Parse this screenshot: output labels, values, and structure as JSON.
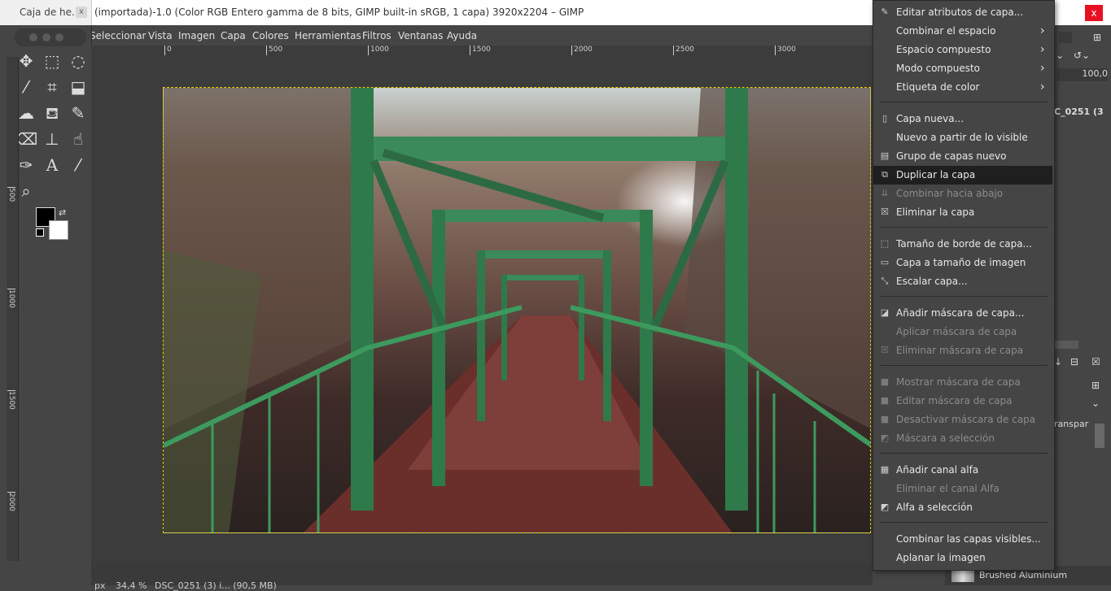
{
  "window": {
    "toolbox_title": "Caja de he...",
    "toolbox_close": "x",
    "title": "(importada)-1.0 (Color RGB Entero gamma de 8 bits, GIMP built-in sRGB, 1 capa) 3920x2204 – GIMP",
    "close": "x"
  },
  "menubar": [
    "Seleccionar",
    "Vista",
    "Imagen",
    "Capa",
    "Colores",
    "Herramientas",
    "Filtros",
    "Ventanas",
    "Ayuda"
  ],
  "ruler": {
    "horizontal": [
      "0",
      "500",
      "1000",
      "1500",
      "2000",
      "2500",
      "3000"
    ],
    "vertical": [
      "500",
      "1000",
      "1500",
      "2000"
    ]
  },
  "tools": {
    "move": "move-icon",
    "rect_select": "rect-select-icon",
    "lasso": "lasso-icon",
    "fuzzy": "fuzzy-select-icon",
    "crop": "crop-icon",
    "transform": "transform-icon",
    "warp": "warp-icon",
    "bucket": "bucket-fill-icon",
    "paintbrush": "paintbrush-icon",
    "eraser": "eraser-icon",
    "clone": "clone-icon",
    "smudge": "smudge-icon",
    "paths": "paths-icon",
    "text": "text-icon",
    "picker": "color-picker-icon",
    "zoom": "zoom-icon"
  },
  "right_dock": {
    "opacity": "100,0",
    "layer_name": "C_0251 (3",
    "mode_text": "ranspar",
    "pattern_name": "Brushed Aluminium"
  },
  "statusbar": {
    "unit": "px",
    "zoom": "34,4 %",
    "info": "DSC_0251 (3) i...  (90,5 MB)"
  },
  "context_menu": {
    "items": [
      {
        "label": "Editar atributos de capa...",
        "icon": "edit-attributes-icon",
        "disabled": false,
        "submenu": false
      },
      {
        "label": "Combinar el espacio",
        "icon": "",
        "disabled": false,
        "submenu": true
      },
      {
        "label": "Espacio compuesto",
        "icon": "",
        "disabled": false,
        "submenu": true
      },
      {
        "label": "Modo compuesto",
        "icon": "",
        "disabled": false,
        "submenu": true
      },
      {
        "label": "Etiqueta de color",
        "icon": "",
        "disabled": false,
        "submenu": true
      },
      {
        "label": "Capa nueva...",
        "icon": "new-layer-icon",
        "disabled": false,
        "submenu": false
      },
      {
        "label": "Nuevo a partir de lo visible",
        "icon": "",
        "disabled": false,
        "submenu": false
      },
      {
        "label": "Grupo de capas nuevo",
        "icon": "layer-group-icon",
        "disabled": false,
        "submenu": false
      },
      {
        "label": "Duplicar la capa",
        "icon": "duplicate-layer-icon",
        "disabled": false,
        "submenu": false,
        "highlighted": true
      },
      {
        "label": "Combinar hacia abajo",
        "icon": "merge-down-icon",
        "disabled": true,
        "submenu": false
      },
      {
        "label": "Eliminar la capa",
        "icon": "delete-layer-icon",
        "disabled": false,
        "submenu": false
      },
      {
        "label": "Tamaño de borde de capa...",
        "icon": "layer-boundary-icon",
        "disabled": false,
        "submenu": false
      },
      {
        "label": "Capa a tamaño de imagen",
        "icon": "layer-to-image-icon",
        "disabled": false,
        "submenu": false
      },
      {
        "label": "Escalar capa...",
        "icon": "scale-layer-icon",
        "disabled": false,
        "submenu": false
      },
      {
        "label": "Añadir máscara de capa...",
        "icon": "add-mask-icon",
        "disabled": false,
        "submenu": false
      },
      {
        "label": "Aplicar máscara de capa",
        "icon": "",
        "disabled": true,
        "submenu": false
      },
      {
        "label": "Eliminar máscara de capa",
        "icon": "delete-mask-icon",
        "disabled": true,
        "submenu": false
      },
      {
        "label": "Mostrar máscara de capa",
        "icon": "checkbox-icon",
        "disabled": true,
        "submenu": false
      },
      {
        "label": "Editar máscara de capa",
        "icon": "checkbox-icon",
        "disabled": true,
        "submenu": false
      },
      {
        "label": "Desactivar máscara de capa",
        "icon": "checkbox-icon",
        "disabled": true,
        "submenu": false
      },
      {
        "label": "Máscara a selección",
        "icon": "mask-to-selection-icon",
        "disabled": true,
        "submenu": false
      },
      {
        "label": "Añadir canal alfa",
        "icon": "alpha-channel-icon",
        "disabled": false,
        "submenu": false
      },
      {
        "label": "Eliminar el canal Alfa",
        "icon": "",
        "disabled": true,
        "submenu": false
      },
      {
        "label": "Alfa a selección",
        "icon": "alpha-to-selection-icon",
        "disabled": false,
        "submenu": false
      },
      {
        "label": "Combinar las capas visibles...",
        "icon": "",
        "disabled": false,
        "submenu": false
      },
      {
        "label": "Aplanar la imagen",
        "icon": "",
        "disabled": false,
        "submenu": false
      }
    ]
  },
  "colors": {
    "accent_selection": "#e6d000",
    "menu_highlight": "#1f1f1f",
    "close_button": "#e81123"
  }
}
